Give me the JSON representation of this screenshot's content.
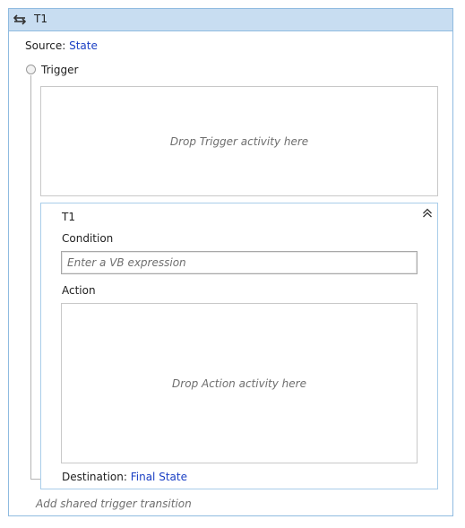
{
  "header": {
    "title": "T1",
    "icon": "swap-arrows-icon"
  },
  "source": {
    "label": "Source:",
    "value": "State"
  },
  "trigger": {
    "label": "Trigger",
    "drop_hint": "Drop Trigger activity here"
  },
  "transition": {
    "title": "T1",
    "collapse_icon": "double-chevron-up-icon",
    "condition_label": "Condition",
    "condition_placeholder": "Enter a VB expression",
    "action_label": "Action",
    "action_drop_hint": "Drop Action activity here",
    "destination_label": "Destination:",
    "destination_value": "Final State"
  },
  "add_shared_trigger": "Add shared trigger transition",
  "colors": {
    "header_bg": "#c8ddf1",
    "border": "#8fbbe0",
    "link": "#1a3fc4",
    "hint": "#6e6e6e"
  }
}
